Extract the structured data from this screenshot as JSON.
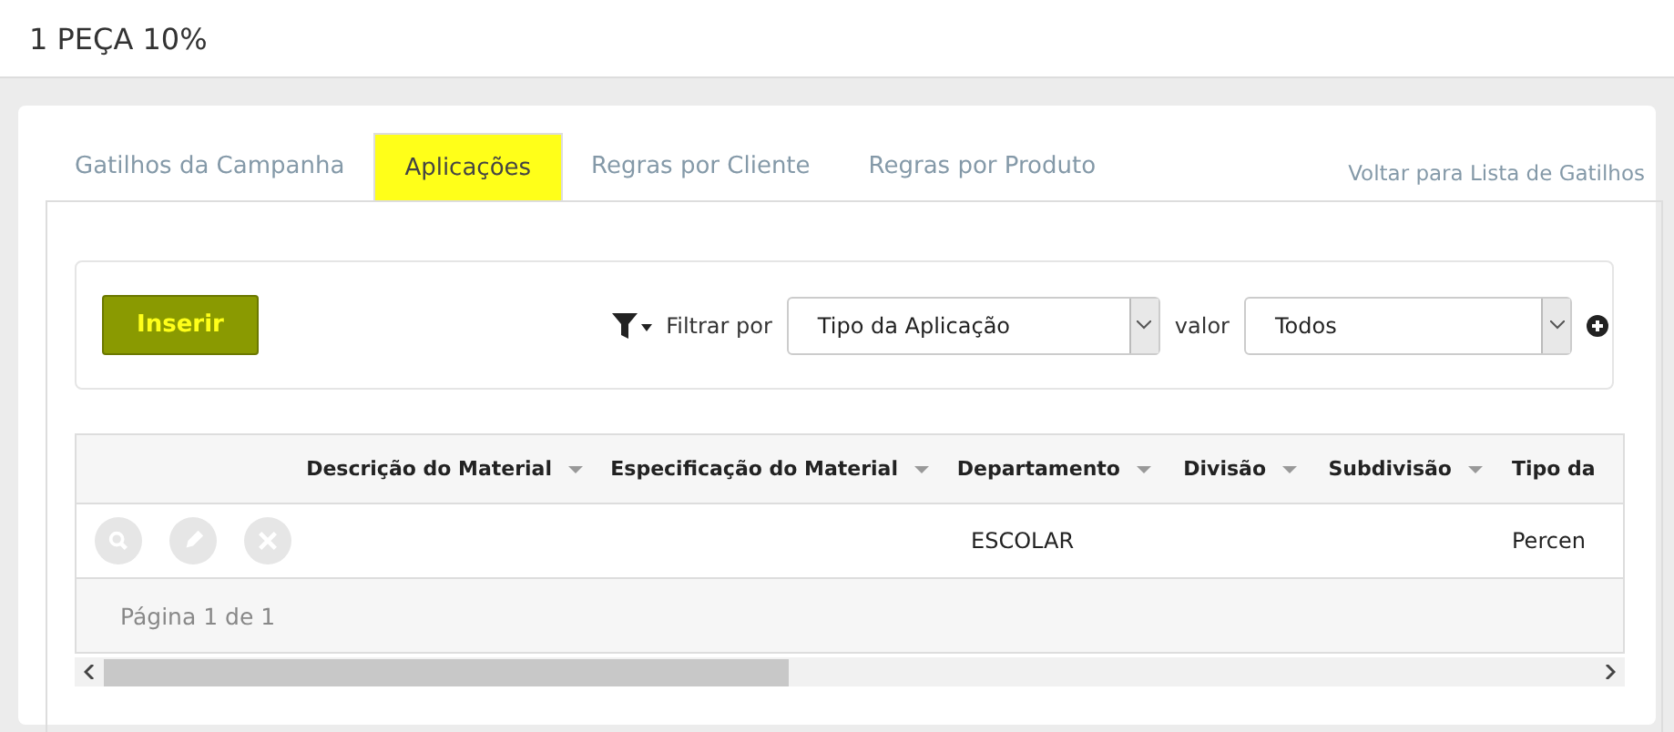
{
  "page_title": "1 PEÇA 10%",
  "tabs": [
    {
      "label": "Gatilhos da Campanha",
      "selected": false
    },
    {
      "label": "Aplicações",
      "selected": true
    },
    {
      "label": "Regras por Cliente",
      "selected": false
    },
    {
      "label": "Regras por Produto",
      "selected": false
    }
  ],
  "back_link": "Voltar para Lista de Gatilhos",
  "toolbar": {
    "insert_button": "Inserir",
    "filter_label": "Filtrar por",
    "filter_field": "Tipo da Aplicação",
    "value_label": "valor",
    "value_field": "Todos"
  },
  "table": {
    "columns": [
      "Descrição do Material",
      "Especificação do Material",
      "Departamento",
      "Divisão",
      "Subdivisão",
      "Tipo da"
    ],
    "rows": [
      {
        "cells": [
          "",
          "",
          "ESCOLAR",
          "",
          "",
          "Percen"
        ]
      }
    ],
    "pager": "Página 1 de 1"
  }
}
